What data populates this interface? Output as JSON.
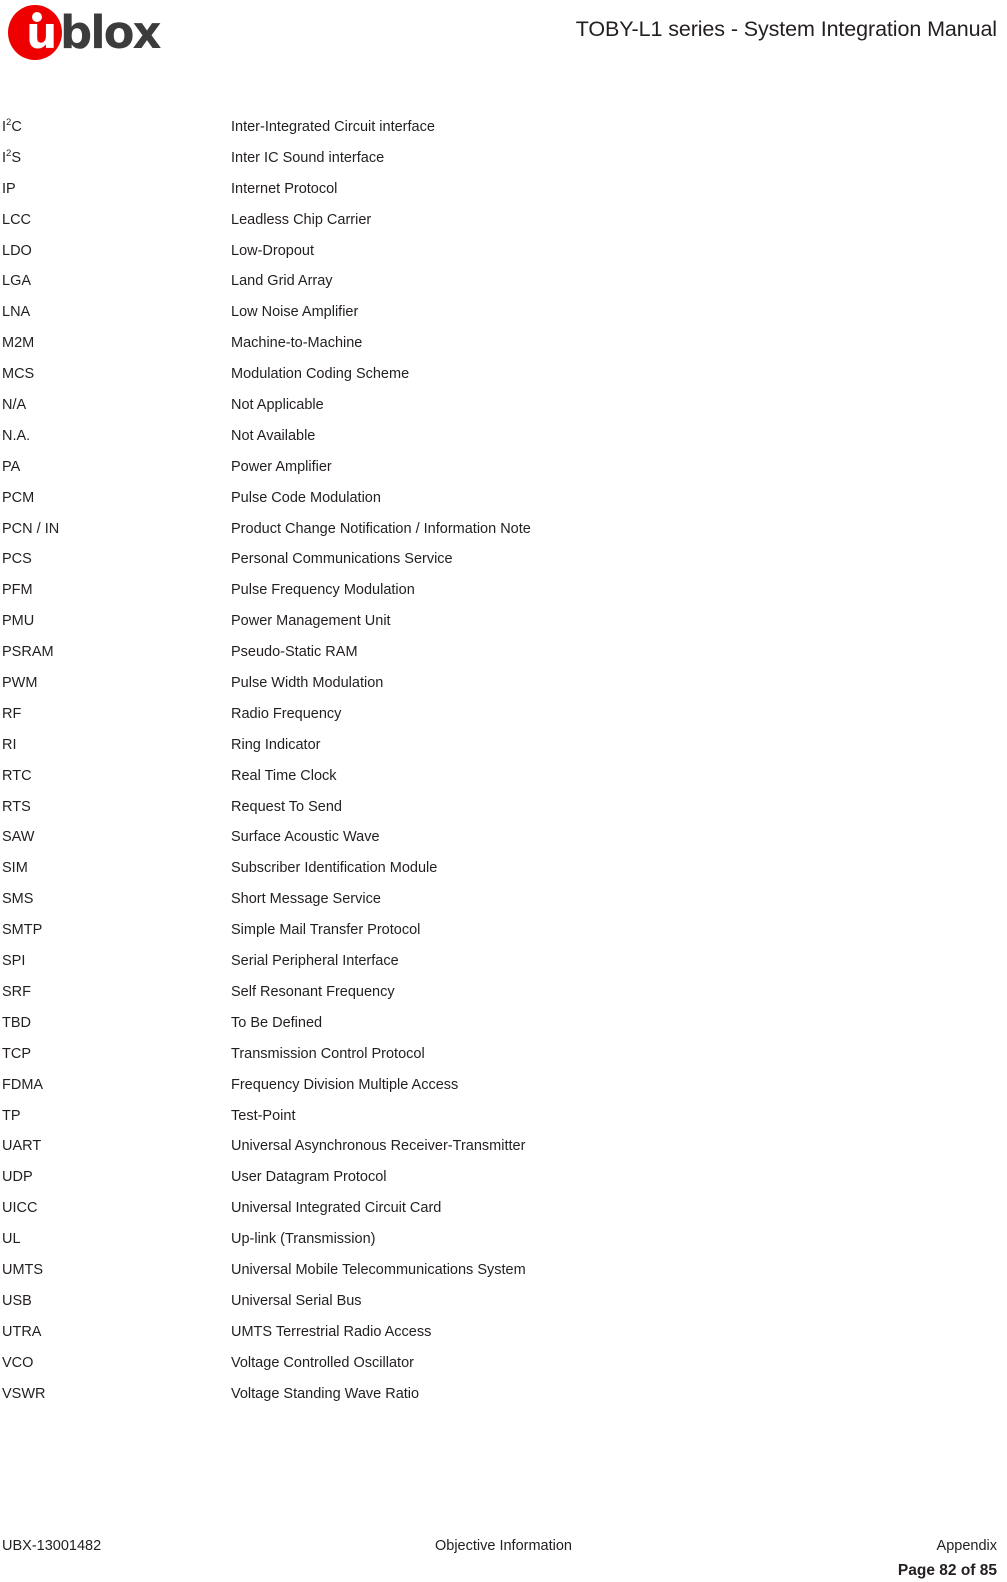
{
  "header": {
    "logo": {
      "mark_letter": "u",
      "wordmark": "blox",
      "brand_color": "#ee0000",
      "wordmark_color": "#3c3c3c"
    },
    "title": "TOBY-L1 series - System Integration Manual"
  },
  "glossary": {
    "rows": [
      {
        "term": "I",
        "term_sup": "2",
        "term_tail": "C",
        "definition": "Inter-Integrated Circuit interface"
      },
      {
        "term": "I",
        "term_sup": "2",
        "term_tail": "S",
        "definition": "Inter IC Sound interface"
      },
      {
        "term": "IP",
        "definition": "Internet Protocol"
      },
      {
        "term": "LCC",
        "definition": "Leadless Chip Carrier"
      },
      {
        "term": "LDO",
        "definition": "Low-Dropout"
      },
      {
        "term": "LGA",
        "definition": "Land Grid Array"
      },
      {
        "term": "LNA",
        "definition": "Low Noise Amplifier"
      },
      {
        "term": "M2M",
        "definition": "Machine-to-Machine"
      },
      {
        "term": "MCS",
        "definition": "Modulation Coding Scheme"
      },
      {
        "term": "N/A",
        "definition": "Not Applicable"
      },
      {
        "term": "N.A.",
        "definition": "Not Available"
      },
      {
        "term": "PA",
        "definition": "Power Amplifier"
      },
      {
        "term": "PCM",
        "definition": "Pulse Code Modulation"
      },
      {
        "term": "PCN / IN",
        "definition": "Product Change Notification / Information Note"
      },
      {
        "term": "PCS",
        "definition": "Personal Communications Service"
      },
      {
        "term": "PFM",
        "definition": "Pulse Frequency Modulation"
      },
      {
        "term": "PMU",
        "definition": "Power Management Unit"
      },
      {
        "term": "PSRAM",
        "definition": "Pseudo-Static RAM"
      },
      {
        "term": "PWM",
        "definition": "Pulse Width Modulation"
      },
      {
        "term": "RF",
        "definition": "Radio Frequency"
      },
      {
        "term": "RI",
        "definition": "Ring Indicator"
      },
      {
        "term": "RTC",
        "definition": "Real Time Clock"
      },
      {
        "term": "RTS",
        "definition": "Request To Send"
      },
      {
        "term": "SAW",
        "definition": "Surface Acoustic Wave"
      },
      {
        "term": "SIM",
        "definition": "Subscriber Identification Module"
      },
      {
        "term": "SMS",
        "definition": "Short Message Service"
      },
      {
        "term": "SMTP",
        "definition": "Simple Mail Transfer Protocol"
      },
      {
        "term": "SPI",
        "definition": "Serial Peripheral Interface"
      },
      {
        "term": "SRF",
        "definition": "Self Resonant Frequency"
      },
      {
        "term": "TBD",
        "definition": "To Be Defined"
      },
      {
        "term": "TCP",
        "definition": "Transmission Control Protocol"
      },
      {
        "term": "FDMA",
        "definition": "Frequency Division Multiple Access"
      },
      {
        "term": "TP",
        "definition": "Test-Point"
      },
      {
        "term": "UART",
        "definition": "Universal Asynchronous Receiver-Transmitter"
      },
      {
        "term": "UDP",
        "definition": "User Datagram Protocol"
      },
      {
        "term": "UICC",
        "definition": "Universal Integrated Circuit Card"
      },
      {
        "term": "UL",
        "definition": "Up-link (Transmission)"
      },
      {
        "term": "UMTS",
        "definition": "Universal Mobile Telecommunications System"
      },
      {
        "term": "USB",
        "definition": "Universal Serial Bus"
      },
      {
        "term": "UTRA",
        "definition": "UMTS Terrestrial Radio Access"
      },
      {
        "term": "VCO",
        "definition": "Voltage Controlled Oscillator"
      },
      {
        "term": "VSWR",
        "definition": "Voltage Standing Wave Ratio"
      }
    ]
  },
  "footer": {
    "doc_number": "UBX-13001482",
    "status": "Objective Information",
    "section": "Appendix",
    "page_label": "Page 82 of 85"
  }
}
